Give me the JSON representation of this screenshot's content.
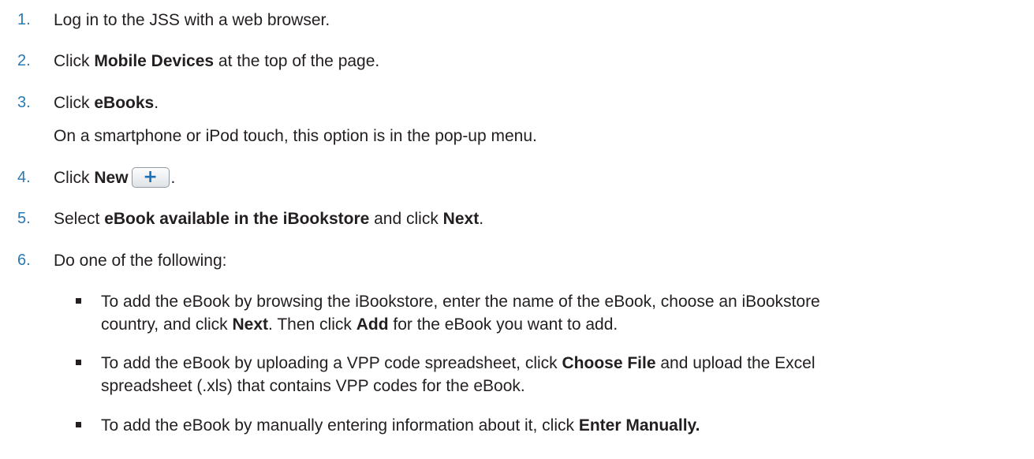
{
  "steps": [
    {
      "num": "1.",
      "parts": [
        "Log in to the JSS with a web browser."
      ]
    },
    {
      "num": "2.",
      "pre": "Click ",
      "bold": "Mobile Devices",
      "post": " at the top of the page."
    },
    {
      "num": "3.",
      "pre": "Click ",
      "bold": "eBooks",
      "post": ".",
      "note": "On a smartphone or iPod touch, this option is in the pop-up menu."
    },
    {
      "num": "4.",
      "pre": "Click ",
      "bold": "New",
      "post": ".",
      "button_icon": "plus-icon"
    },
    {
      "num": "5.",
      "pre": "Select ",
      "bold": "eBook available in the iBookstore",
      "mid": " and click ",
      "bold2": "Next",
      "post": "."
    },
    {
      "num": "6.",
      "text": "Do one of the following:"
    }
  ],
  "bullets": [
    {
      "line1_pre": "To add the eBook by browsing the iBookstore, enter the name of the eBook, choose an iBookstore",
      "line2_pre": "country, and click ",
      "line2_bold": "Next",
      "line2_mid": ". Then click ",
      "line2_bold2": "Add",
      "line2_post": " for the eBook you want to add."
    },
    {
      "line1_pre": "To add the eBook by uploading a VPP code spreadsheet, click ",
      "line1_bold": "Choose File",
      "line1_post": " and upload the Excel",
      "line2_pre": "spreadsheet (.xls) that contains VPP codes for the eBook."
    },
    {
      "line1_pre": "To add the eBook by manually entering information about it, click ",
      "line1_bold": "Enter Manually."
    }
  ],
  "colors": {
    "step_number": "#2a7ab0",
    "text": "#231f20",
    "plus_icon": "#1f6fb4"
  }
}
